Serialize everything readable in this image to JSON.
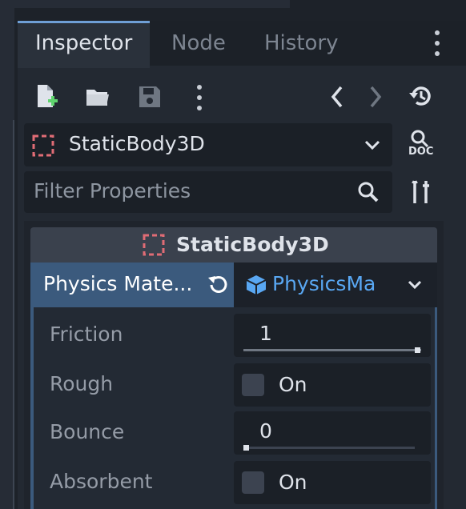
{
  "tabs": [
    {
      "label": "Inspector",
      "active": true
    },
    {
      "label": "Node",
      "active": false
    },
    {
      "label": "History",
      "active": false
    }
  ],
  "toolbar": {
    "icons": [
      "new-resource-icon",
      "open-folder-icon",
      "save-icon",
      "more-icon",
      "back-icon",
      "forward-icon",
      "history-icon"
    ]
  },
  "object_selector": {
    "name": "StaticBody3D",
    "doc_label": "DOC"
  },
  "filter": {
    "placeholder": "Filter Properties"
  },
  "section": {
    "title": "StaticBody3D"
  },
  "physics_material": {
    "label": "Physics Mate...",
    "resource_name": "PhysicsMa"
  },
  "properties": [
    {
      "name": "Friction",
      "value": "1",
      "slider": 1.0
    },
    {
      "name": "Rough",
      "checked": false,
      "text": "On"
    },
    {
      "name": "Bounce",
      "value": "0",
      "slider": 0.0
    },
    {
      "name": "Absorbent",
      "checked": false,
      "text": "On"
    }
  ],
  "colors": {
    "accent": "#6f9fd6",
    "node_red": "#e06c75",
    "resource_blue": "#59a7f2"
  }
}
